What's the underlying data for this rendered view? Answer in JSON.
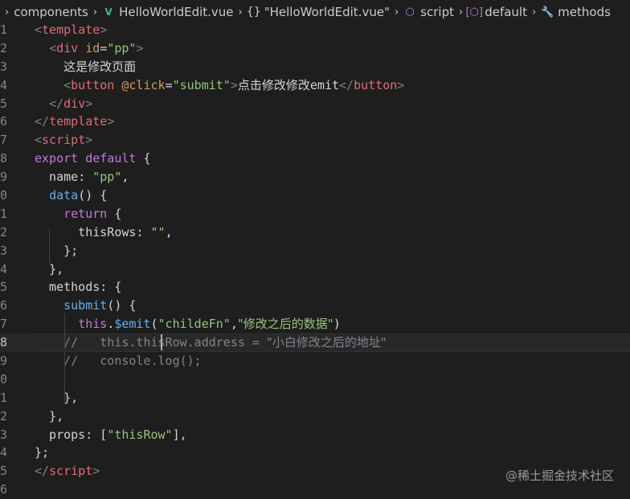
{
  "breadcrumb": {
    "items": [
      {
        "label": "components",
        "icon": null
      },
      {
        "label": "HelloWorldEdit.vue",
        "icon": "vue-file-icon"
      },
      {
        "label": "\"HelloWorldEdit.vue\"",
        "icon": "braces-icon"
      },
      {
        "label": "script",
        "icon": "cube-icon"
      },
      {
        "label": "default",
        "icon": "bracket-cube-icon"
      },
      {
        "label": "methods",
        "icon": "wrench-icon"
      }
    ]
  },
  "editor": {
    "current_line": 18,
    "lines": [
      {
        "num": "1",
        "segments": [
          {
            "t": "<",
            "c": "punct"
          },
          {
            "t": "template",
            "c": "tag"
          },
          {
            "t": ">",
            "c": "punct"
          }
        ]
      },
      {
        "num": "2",
        "segments": [
          {
            "t": "  ",
            "c": "text"
          },
          {
            "t": "<",
            "c": "punct"
          },
          {
            "t": "div",
            "c": "tag"
          },
          {
            "t": " ",
            "c": "text"
          },
          {
            "t": "id",
            "c": "attr"
          },
          {
            "t": "=",
            "c": "text"
          },
          {
            "t": "\"pp\"",
            "c": "str"
          },
          {
            "t": ">",
            "c": "punct"
          }
        ]
      },
      {
        "num": "3",
        "segments": [
          {
            "t": "    ",
            "c": "text"
          },
          {
            "t": "这是修改页面",
            "c": "cn"
          }
        ]
      },
      {
        "num": "4",
        "segments": [
          {
            "t": "    ",
            "c": "text"
          },
          {
            "t": "<",
            "c": "punct"
          },
          {
            "t": "button",
            "c": "tag"
          },
          {
            "t": " ",
            "c": "text"
          },
          {
            "t": "@click",
            "c": "attr"
          },
          {
            "t": "=",
            "c": "text"
          },
          {
            "t": "\"submit\"",
            "c": "str"
          },
          {
            "t": ">",
            "c": "punct"
          },
          {
            "t": "点击修改修改",
            "c": "cn"
          },
          {
            "t": "emit",
            "c": "text"
          },
          {
            "t": "</",
            "c": "punct"
          },
          {
            "t": "button",
            "c": "tag"
          },
          {
            "t": ">",
            "c": "punct"
          }
        ]
      },
      {
        "num": "5",
        "segments": [
          {
            "t": "  ",
            "c": "text"
          },
          {
            "t": "</",
            "c": "punct"
          },
          {
            "t": "div",
            "c": "tag"
          },
          {
            "t": ">",
            "c": "punct"
          }
        ]
      },
      {
        "num": "6",
        "segments": [
          {
            "t": "</",
            "c": "punct"
          },
          {
            "t": "template",
            "c": "tag"
          },
          {
            "t": ">",
            "c": "punct"
          }
        ]
      },
      {
        "num": "7",
        "segments": [
          {
            "t": "<",
            "c": "punct"
          },
          {
            "t": "script",
            "c": "tag"
          },
          {
            "t": ">",
            "c": "punct"
          }
        ]
      },
      {
        "num": "8",
        "segments": [
          {
            "t": "export",
            "c": "kw"
          },
          {
            "t": " ",
            "c": "text"
          },
          {
            "t": "default",
            "c": "kw"
          },
          {
            "t": " {",
            "c": "text"
          }
        ]
      },
      {
        "num": "9",
        "segments": [
          {
            "t": "  name",
            "c": "text"
          },
          {
            "t": ": ",
            "c": "text"
          },
          {
            "t": "\"pp\"",
            "c": "str"
          },
          {
            "t": ",",
            "c": "text"
          }
        ]
      },
      {
        "num": "0",
        "segments": [
          {
            "t": "  ",
            "c": "text"
          },
          {
            "t": "data",
            "c": "fn"
          },
          {
            "t": "() {",
            "c": "text"
          }
        ]
      },
      {
        "num": "1",
        "segments": [
          {
            "t": "    ",
            "c": "text"
          },
          {
            "t": "return",
            "c": "kw"
          },
          {
            "t": " {",
            "c": "text"
          }
        ]
      },
      {
        "num": "2",
        "segments": [
          {
            "t": "      thisRows",
            "c": "text"
          },
          {
            "t": ": ",
            "c": "text"
          },
          {
            "t": "\"\"",
            "c": "str"
          },
          {
            "t": ",",
            "c": "text"
          }
        ]
      },
      {
        "num": "3",
        "segments": [
          {
            "t": "    };",
            "c": "text"
          }
        ]
      },
      {
        "num": "4",
        "segments": [
          {
            "t": "  },",
            "c": "text"
          }
        ]
      },
      {
        "num": "5",
        "segments": [
          {
            "t": "  methods",
            "c": "text"
          },
          {
            "t": ": {",
            "c": "text"
          }
        ]
      },
      {
        "num": "6",
        "segments": [
          {
            "t": "    ",
            "c": "text"
          },
          {
            "t": "submit",
            "c": "fn"
          },
          {
            "t": "() {",
            "c": "text"
          }
        ]
      },
      {
        "num": "7",
        "segments": [
          {
            "t": "      ",
            "c": "text"
          },
          {
            "t": "this",
            "c": "kw"
          },
          {
            "t": ".",
            "c": "text"
          },
          {
            "t": "$emit",
            "c": "fn"
          },
          {
            "t": "(",
            "c": "text"
          },
          {
            "t": "\"childeFn\"",
            "c": "str"
          },
          {
            "t": ",",
            "c": "text"
          },
          {
            "t": "\"修改之后的数据\"",
            "c": "strcn"
          },
          {
            "t": ")",
            "c": "text"
          }
        ]
      },
      {
        "num": "8",
        "segments": [
          {
            "t": "    //   this.thisRow.address = ",
            "c": "comment"
          },
          {
            "t": "\"小白修改之后的地址\"",
            "c": "commentcn"
          }
        ]
      },
      {
        "num": "9",
        "segments": [
          {
            "t": "    //   console.log();",
            "c": "comment"
          }
        ]
      },
      {
        "num": "0",
        "segments": []
      },
      {
        "num": "1",
        "segments": [
          {
            "t": "    },",
            "c": "text"
          }
        ]
      },
      {
        "num": "2",
        "segments": [
          {
            "t": "  },",
            "c": "text"
          }
        ]
      },
      {
        "num": "3",
        "segments": [
          {
            "t": "  props",
            "c": "text"
          },
          {
            "t": ": [",
            "c": "text"
          },
          {
            "t": "\"thisRow\"",
            "c": "str"
          },
          {
            "t": "],",
            "c": "text"
          }
        ]
      },
      {
        "num": "4",
        "segments": [
          {
            "t": "};",
            "c": "text"
          }
        ]
      },
      {
        "num": "5",
        "segments": [
          {
            "t": "</",
            "c": "punct"
          },
          {
            "t": "script",
            "c": "tag"
          },
          {
            "t": ">",
            "c": "punct"
          }
        ]
      },
      {
        "num": "6",
        "segments": []
      }
    ]
  },
  "watermark": "@稀土掘金技术社区",
  "colors": {
    "background": "#1e1e1e",
    "tag": "#e06c75",
    "string": "#98c379",
    "keyword": "#c678dd",
    "function": "#61afef",
    "comment": "#7f848e"
  }
}
